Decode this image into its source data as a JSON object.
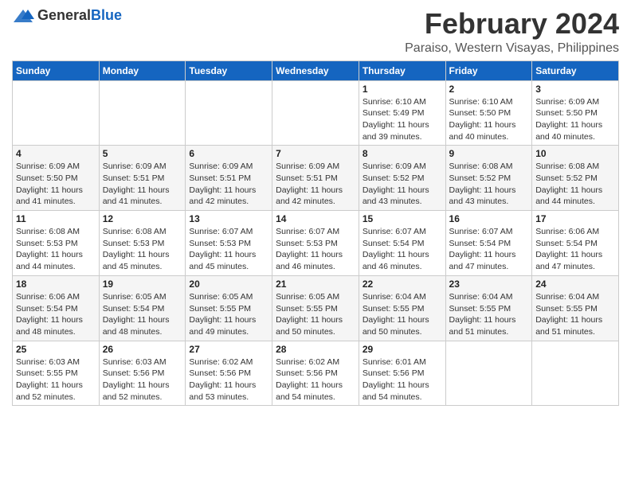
{
  "header": {
    "logo_general": "General",
    "logo_blue": "Blue",
    "month_year": "February 2024",
    "location": "Paraiso, Western Visayas, Philippines"
  },
  "days_of_week": [
    "Sunday",
    "Monday",
    "Tuesday",
    "Wednesday",
    "Thursday",
    "Friday",
    "Saturday"
  ],
  "weeks": [
    [
      {
        "day": "",
        "info": ""
      },
      {
        "day": "",
        "info": ""
      },
      {
        "day": "",
        "info": ""
      },
      {
        "day": "",
        "info": ""
      },
      {
        "day": "1",
        "info": "Sunrise: 6:10 AM\nSunset: 5:49 PM\nDaylight: 11 hours and 39 minutes."
      },
      {
        "day": "2",
        "info": "Sunrise: 6:10 AM\nSunset: 5:50 PM\nDaylight: 11 hours and 40 minutes."
      },
      {
        "day": "3",
        "info": "Sunrise: 6:09 AM\nSunset: 5:50 PM\nDaylight: 11 hours and 40 minutes."
      }
    ],
    [
      {
        "day": "4",
        "info": "Sunrise: 6:09 AM\nSunset: 5:50 PM\nDaylight: 11 hours and 41 minutes."
      },
      {
        "day": "5",
        "info": "Sunrise: 6:09 AM\nSunset: 5:51 PM\nDaylight: 11 hours and 41 minutes."
      },
      {
        "day": "6",
        "info": "Sunrise: 6:09 AM\nSunset: 5:51 PM\nDaylight: 11 hours and 42 minutes."
      },
      {
        "day": "7",
        "info": "Sunrise: 6:09 AM\nSunset: 5:51 PM\nDaylight: 11 hours and 42 minutes."
      },
      {
        "day": "8",
        "info": "Sunrise: 6:09 AM\nSunset: 5:52 PM\nDaylight: 11 hours and 43 minutes."
      },
      {
        "day": "9",
        "info": "Sunrise: 6:08 AM\nSunset: 5:52 PM\nDaylight: 11 hours and 43 minutes."
      },
      {
        "day": "10",
        "info": "Sunrise: 6:08 AM\nSunset: 5:52 PM\nDaylight: 11 hours and 44 minutes."
      }
    ],
    [
      {
        "day": "11",
        "info": "Sunrise: 6:08 AM\nSunset: 5:53 PM\nDaylight: 11 hours and 44 minutes."
      },
      {
        "day": "12",
        "info": "Sunrise: 6:08 AM\nSunset: 5:53 PM\nDaylight: 11 hours and 45 minutes."
      },
      {
        "day": "13",
        "info": "Sunrise: 6:07 AM\nSunset: 5:53 PM\nDaylight: 11 hours and 45 minutes."
      },
      {
        "day": "14",
        "info": "Sunrise: 6:07 AM\nSunset: 5:53 PM\nDaylight: 11 hours and 46 minutes."
      },
      {
        "day": "15",
        "info": "Sunrise: 6:07 AM\nSunset: 5:54 PM\nDaylight: 11 hours and 46 minutes."
      },
      {
        "day": "16",
        "info": "Sunrise: 6:07 AM\nSunset: 5:54 PM\nDaylight: 11 hours and 47 minutes."
      },
      {
        "day": "17",
        "info": "Sunrise: 6:06 AM\nSunset: 5:54 PM\nDaylight: 11 hours and 47 minutes."
      }
    ],
    [
      {
        "day": "18",
        "info": "Sunrise: 6:06 AM\nSunset: 5:54 PM\nDaylight: 11 hours and 48 minutes."
      },
      {
        "day": "19",
        "info": "Sunrise: 6:05 AM\nSunset: 5:54 PM\nDaylight: 11 hours and 48 minutes."
      },
      {
        "day": "20",
        "info": "Sunrise: 6:05 AM\nSunset: 5:55 PM\nDaylight: 11 hours and 49 minutes."
      },
      {
        "day": "21",
        "info": "Sunrise: 6:05 AM\nSunset: 5:55 PM\nDaylight: 11 hours and 50 minutes."
      },
      {
        "day": "22",
        "info": "Sunrise: 6:04 AM\nSunset: 5:55 PM\nDaylight: 11 hours and 50 minutes."
      },
      {
        "day": "23",
        "info": "Sunrise: 6:04 AM\nSunset: 5:55 PM\nDaylight: 11 hours and 51 minutes."
      },
      {
        "day": "24",
        "info": "Sunrise: 6:04 AM\nSunset: 5:55 PM\nDaylight: 11 hours and 51 minutes."
      }
    ],
    [
      {
        "day": "25",
        "info": "Sunrise: 6:03 AM\nSunset: 5:55 PM\nDaylight: 11 hours and 52 minutes."
      },
      {
        "day": "26",
        "info": "Sunrise: 6:03 AM\nSunset: 5:56 PM\nDaylight: 11 hours and 52 minutes."
      },
      {
        "day": "27",
        "info": "Sunrise: 6:02 AM\nSunset: 5:56 PM\nDaylight: 11 hours and 53 minutes."
      },
      {
        "day": "28",
        "info": "Sunrise: 6:02 AM\nSunset: 5:56 PM\nDaylight: 11 hours and 54 minutes."
      },
      {
        "day": "29",
        "info": "Sunrise: 6:01 AM\nSunset: 5:56 PM\nDaylight: 11 hours and 54 minutes."
      },
      {
        "day": "",
        "info": ""
      },
      {
        "day": "",
        "info": ""
      }
    ]
  ]
}
